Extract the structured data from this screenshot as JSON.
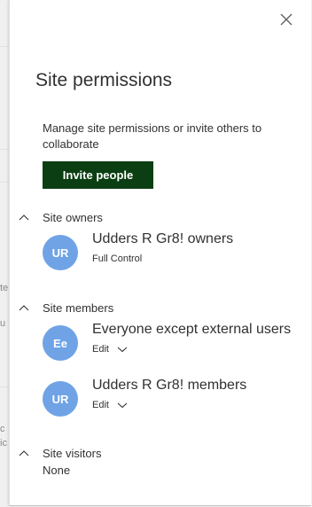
{
  "background": {
    "fragments": [
      "te",
      "u",
      "c",
      "ic"
    ]
  },
  "panel": {
    "title": "Site permissions",
    "description": "Manage site permissions or invite others to collaborate",
    "invite_label": "Invite people",
    "colors": {
      "invite_button": "#0b3e12",
      "avatar": "#6fa3e6"
    }
  },
  "sections": {
    "owners": {
      "label": "Site owners",
      "members": [
        {
          "initials": "UR",
          "name": "Udders R Gr8! owners",
          "permission": "Full Control",
          "has_dropdown": false
        }
      ]
    },
    "members": {
      "label": "Site members",
      "members": [
        {
          "initials": "Ee",
          "name": "Everyone except external users",
          "permission": "Edit",
          "has_dropdown": true
        },
        {
          "initials": "UR",
          "name": "Udders R Gr8! members",
          "permission": "Edit",
          "has_dropdown": true
        }
      ]
    },
    "visitors": {
      "label": "Site visitors",
      "empty_text": "None"
    }
  },
  "icons": {
    "close": "close-icon",
    "collapse": "chevron-up-icon",
    "dropdown": "chevron-down-icon"
  }
}
